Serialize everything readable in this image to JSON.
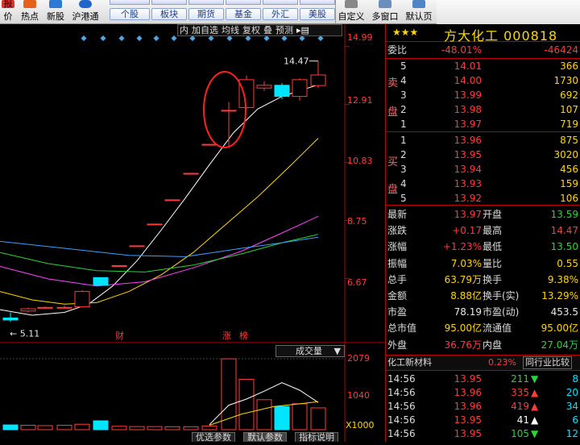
{
  "toolbar": {
    "items": [
      {
        "label": "报价",
        "name": "quote-tool"
      },
      {
        "label": "热点",
        "name": "hotspot-tool"
      },
      {
        "label": "新股",
        "name": "new-stock-tool"
      },
      {
        "label": "沪港通",
        "name": "hk-connect-tool"
      }
    ],
    "markets_row2": [
      "个股",
      "板块",
      "期货",
      "基金",
      "外汇",
      "美股"
    ],
    "right_items": [
      {
        "label": "自定义",
        "name": "customize-tool"
      },
      {
        "label": "多窗口",
        "name": "multi-window-tool"
      },
      {
        "label": "默认页",
        "name": "default-page-tool"
      }
    ]
  },
  "chart_toolbar": {
    "items": [
      "内",
      "加自选",
      "均线",
      "复权",
      "叠",
      "预测"
    ],
    "menu_icon": "arrow-menu-icon"
  },
  "price_axis": [
    "14.99",
    "12.91",
    "10.83",
    "8.75",
    "6.67"
  ],
  "volume_axis": [
    "2079",
    "1040",
    "X1000"
  ],
  "chart_labels": {
    "high_marker": "14.47",
    "low_marker": "5.11",
    "event_1": "财",
    "event_2": "涨",
    "event_3": "榜",
    "volume_selector": "成交量"
  },
  "bottom_tabs": [
    "优选参数",
    "默认参数",
    "指标说明"
  ],
  "stock": {
    "stars": "★★★",
    "name": "方大化工",
    "code": "000818"
  },
  "order_book": {
    "ratio_label": "委比",
    "ratio": "-48.01%",
    "diff": "-46424",
    "sell_label": "卖盘",
    "buy_label": "买盘",
    "sell": [
      {
        "n": "5",
        "price": "14.01",
        "vol": "366",
        "color": "#ff3b3b"
      },
      {
        "n": "4",
        "price": "14.00",
        "vol": "1730",
        "color": "#ff3b3b"
      },
      {
        "n": "3",
        "price": "13.99",
        "vol": "692",
        "color": "#ff3b3b"
      },
      {
        "n": "2",
        "price": "13.98",
        "vol": "107",
        "color": "#ff3b3b"
      },
      {
        "n": "1",
        "price": "13.97",
        "vol": "719",
        "color": "#ff3b3b"
      }
    ],
    "buy": [
      {
        "n": "1",
        "price": "13.96",
        "vol": "875",
        "color": "#ff3b3b"
      },
      {
        "n": "2",
        "price": "13.95",
        "vol": "3020",
        "color": "#ff3b3b"
      },
      {
        "n": "3",
        "price": "13.94",
        "vol": "456",
        "color": "#ff3b3b"
      },
      {
        "n": "4",
        "price": "13.93",
        "vol": "159",
        "color": "#ff3b3b"
      },
      {
        "n": "5",
        "price": "13.92",
        "vol": "106",
        "color": "#ff3b3b"
      }
    ]
  },
  "stats": [
    {
      "l1": "最新",
      "v1": "13.97",
      "c1": "#ff3b3b",
      "l2": "开盘",
      "v2": "13.59",
      "c2": "#2ad43a"
    },
    {
      "l1": "涨跌",
      "v1": "+0.17",
      "c1": "#ff3b3b",
      "l2": "最高",
      "v2": "14.47",
      "c2": "#ff3b3b"
    },
    {
      "l1": "涨幅",
      "v1": "+1.23%",
      "c1": "#ff3b3b",
      "l2": "最低",
      "v2": "13.50",
      "c2": "#2ad43a"
    },
    {
      "l1": "振幅",
      "v1": "7.03%",
      "c1": "#ffd700",
      "l2": "量比",
      "v2": "0.55",
      "c2": "#ffd700"
    },
    {
      "l1": "总手",
      "v1": "63.79万",
      "c1": "#ffd700",
      "l2": "换手",
      "v2": "9.38%",
      "c2": "#ffd700"
    },
    {
      "l1": "金额",
      "v1": "8.88亿",
      "c1": "#ffd700",
      "l2": "换手(实)",
      "v2": "13.29%",
      "c2": "#ffd700"
    },
    {
      "l1": "市盈",
      "v1": "78.19",
      "c1": "#e8e8e8",
      "l2": "市盈(动)",
      "v2": "453.5",
      "c2": "#e8e8e8"
    },
    {
      "l1": "总市值",
      "v1": "95.00亿",
      "c1": "#ffd700",
      "l2": "流通值",
      "v2": "95.00亿",
      "c2": "#ffd700"
    },
    {
      "l1": "外盘",
      "v1": "36.76万",
      "c1": "#ff3b3b",
      "l2": "内盘",
      "v2": "27.04万",
      "c2": "#2ad43a"
    }
  ],
  "industry": {
    "name": "化工新材料",
    "change": "0.23%",
    "compare_label": "同行业比较"
  },
  "ticks": [
    {
      "time": "14:56",
      "price": "13.95",
      "vol": "211",
      "dir": "down",
      "n": "8"
    },
    {
      "time": "14:56",
      "price": "13.96",
      "vol": "335",
      "dir": "up",
      "n": "20"
    },
    {
      "time": "14:56",
      "price": "13.96",
      "vol": "419",
      "dir": "up",
      "n": "34"
    },
    {
      "time": "14:56",
      "price": "13.95",
      "vol": "41",
      "dir": "white",
      "n": "6"
    },
    {
      "time": "14:56",
      "price": "13.95",
      "vol": "105",
      "dir": "down",
      "n": "12"
    }
  ],
  "chart_data": {
    "type": "candlestick",
    "ylim": [
      4.8,
      15.3
    ],
    "ohlc": [
      {
        "x": 13,
        "o": 5.25,
        "c": 5.18,
        "h": 5.45,
        "l": 5.11
      },
      {
        "x": 35,
        "o": 5.5,
        "c": 5.58,
        "h": 5.62,
        "l": 5.45
      },
      {
        "x": 56,
        "o": 5.6,
        "c": 5.63,
        "h": 5.66,
        "l": 5.57
      },
      {
        "x": 80,
        "o": 5.62,
        "c": 5.63,
        "h": 5.7,
        "l": 5.58
      },
      {
        "x": 102,
        "o": 5.65,
        "c": 6.2,
        "h": 6.25,
        "l": 5.62
      },
      {
        "x": 125,
        "o": 6.7,
        "c": 6.42,
        "h": 6.72,
        "l": 6.4
      },
      {
        "x": 148,
        "o": 7.13,
        "c": 7.13,
        "h": 7.13,
        "l": 7.13
      },
      {
        "x": 170,
        "o": 7.84,
        "c": 7.84,
        "h": 7.84,
        "l": 7.84
      },
      {
        "x": 192,
        "o": 8.62,
        "c": 8.62,
        "h": 8.62,
        "l": 8.62
      },
      {
        "x": 214,
        "o": 9.49,
        "c": 9.49,
        "h": 9.49,
        "l": 9.49
      },
      {
        "x": 237,
        "o": 10.44,
        "c": 10.44,
        "h": 10.44,
        "l": 10.44
      },
      {
        "x": 260,
        "o": 11.48,
        "c": 11.48,
        "h": 11.48,
        "l": 11.48
      },
      {
        "x": 284,
        "o": 12.7,
        "c": 12.7,
        "h": 13.0,
        "l": 11.4
      },
      {
        "x": 306,
        "o": 12.8,
        "c": 13.8,
        "h": 13.95,
        "l": 12.75
      },
      {
        "x": 328,
        "o": 13.5,
        "c": 13.6,
        "h": 13.75,
        "l": 13.4
      },
      {
        "x": 350,
        "o": 13.6,
        "c": 13.2,
        "h": 13.68,
        "l": 13.1
      },
      {
        "x": 372,
        "o": 13.2,
        "c": 13.8,
        "h": 13.85,
        "l": 13.05
      },
      {
        "x": 395,
        "o": 13.59,
        "c": 13.97,
        "h": 14.47,
        "l": 13.5
      }
    ],
    "ma": [
      {
        "color": "#ffffff",
        "values": [
          [
            0,
            5.55
          ],
          [
            40,
            5.35
          ],
          [
            80,
            5.45
          ],
          [
            110,
            5.75
          ],
          [
            140,
            6.4
          ],
          [
            170,
            7.3
          ],
          [
            200,
            8.4
          ],
          [
            230,
            9.55
          ],
          [
            260,
            10.75
          ],
          [
            290,
            11.9
          ],
          [
            320,
            12.75
          ],
          [
            350,
            13.2
          ],
          [
            395,
            13.62
          ]
        ]
      },
      {
        "color": "#ffd700",
        "values": [
          [
            0,
            6.2
          ],
          [
            40,
            5.9
          ],
          [
            80,
            5.75
          ],
          [
            120,
            5.8
          ],
          [
            160,
            6.2
          ],
          [
            200,
            6.8
          ],
          [
            240,
            7.6
          ],
          [
            280,
            8.6
          ],
          [
            320,
            9.6
          ],
          [
            360,
            10.7
          ],
          [
            395,
            11.7
          ]
        ]
      },
      {
        "color": "#ff44ff",
        "values": [
          [
            0,
            7.1
          ],
          [
            60,
            6.65
          ],
          [
            120,
            6.4
          ],
          [
            180,
            6.55
          ],
          [
            240,
            7.05
          ],
          [
            300,
            7.65
          ],
          [
            350,
            8.3
          ],
          [
            395,
            8.9
          ]
        ]
      },
      {
        "color": "#2ad43a",
        "values": [
          [
            0,
            7.6
          ],
          [
            60,
            7.2
          ],
          [
            120,
            6.95
          ],
          [
            180,
            6.9
          ],
          [
            240,
            7.15
          ],
          [
            300,
            7.55
          ],
          [
            350,
            7.95
          ],
          [
            395,
            8.25
          ]
        ]
      },
      {
        "color": "#3aa0ff",
        "values": [
          [
            0,
            8.0
          ],
          [
            80,
            7.75
          ],
          [
            160,
            7.5
          ],
          [
            230,
            7.45
          ],
          [
            300,
            7.75
          ],
          [
            350,
            7.95
          ],
          [
            395,
            8.15
          ]
        ]
      }
    ],
    "volume": {
      "ylim": [
        0,
        2200
      ],
      "bars": [
        {
          "x": 13,
          "v": 140,
          "up": false
        },
        {
          "x": 35,
          "v": 130,
          "up": true
        },
        {
          "x": 56,
          "v": 120,
          "up": true
        },
        {
          "x": 80,
          "v": 130,
          "up": true
        },
        {
          "x": 102,
          "v": 160,
          "up": true
        },
        {
          "x": 125,
          "v": 260,
          "up": false
        },
        {
          "x": 148,
          "v": 100,
          "up": true
        },
        {
          "x": 170,
          "v": 90,
          "up": true
        },
        {
          "x": 192,
          "v": 90,
          "up": true
        },
        {
          "x": 214,
          "v": 85,
          "up": true
        },
        {
          "x": 237,
          "v": 85,
          "up": true
        },
        {
          "x": 260,
          "v": 110,
          "up": true
        },
        {
          "x": 284,
          "v": 2079,
          "up": true
        },
        {
          "x": 306,
          "v": 1480,
          "up": true
        },
        {
          "x": 328,
          "v": 880,
          "up": true
        },
        {
          "x": 350,
          "v": 680,
          "up": false
        },
        {
          "x": 372,
          "v": 760,
          "up": true
        },
        {
          "x": 395,
          "v": 640,
          "up": true
        }
      ],
      "ma": [
        {
          "color": "#ffffff",
          "values": [
            [
              260,
              150
            ],
            [
              284,
              720
            ],
            [
              306,
              900
            ],
            [
              328,
              1130
            ],
            [
              350,
              1380
            ],
            [
              372,
              1160
            ],
            [
              395,
              800
            ]
          ]
        },
        {
          "color": "#ffd700",
          "values": [
            [
              260,
              130
            ],
            [
              300,
              460
            ],
            [
              340,
              680
            ],
            [
              372,
              760
            ],
            [
              395,
              820
            ]
          ]
        }
      ]
    }
  }
}
